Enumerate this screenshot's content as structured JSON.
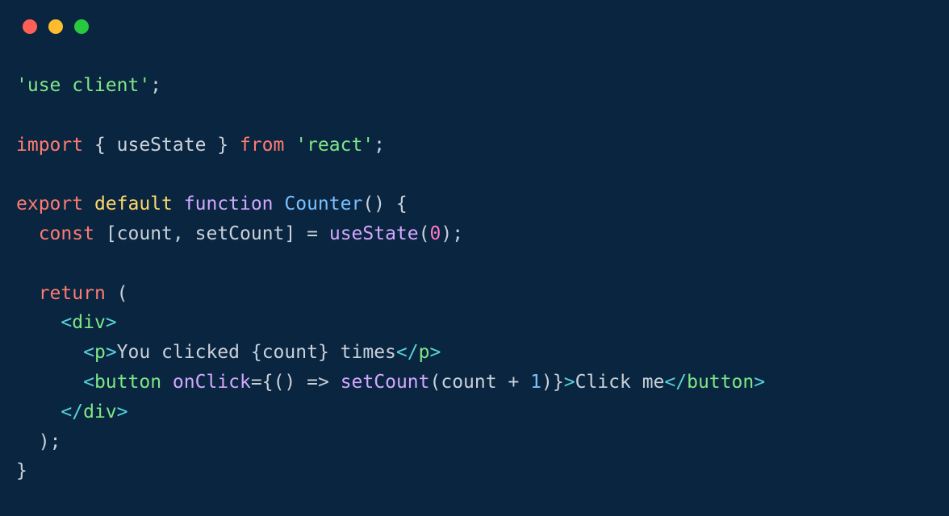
{
  "traffic_lights": {
    "red": "#ff5f57",
    "yellow": "#febc2e",
    "green": "#28c840"
  },
  "code": {
    "line1": {
      "directive": "'use client'",
      "semi": ";"
    },
    "line3": {
      "import_kw": "import",
      "lbrace": " { ",
      "name": "useState",
      "rbrace": " } ",
      "from_kw": "from",
      "sp": " ",
      "module": "'react'",
      "semi": ";"
    },
    "line5": {
      "export_kw": "export",
      "sp1": " ",
      "default_kw": "default",
      "sp2": " ",
      "function_kw": "function",
      "sp3": " ",
      "name": "Counter",
      "parens": "()",
      "sp4": " ",
      "lbrace": "{"
    },
    "line6": {
      "indent": "  ",
      "const_kw": "const",
      "sp": " ",
      "lbracket": "[",
      "var1": "count",
      "comma": ", ",
      "var2": "setCount",
      "rbracket": "]",
      "sp2": " ",
      "eq": "=",
      "sp3": " ",
      "call": "useState",
      "lparen": "(",
      "arg": "0",
      "rparen": ")",
      "semi": ";"
    },
    "line8": {
      "indent": "  ",
      "return_kw": "return",
      "sp": " ",
      "lparen": "("
    },
    "line9": {
      "indent": "    ",
      "lt": "<",
      "tag": "div",
      "gt": ">"
    },
    "line10": {
      "indent": "      ",
      "lt": "<",
      "tag": "p",
      "gt": ">",
      "text1": "You clicked ",
      "lbrace": "{",
      "expr": "count",
      "rbrace": "}",
      "text2": " times",
      "lt2": "</",
      "tag2": "p",
      "gt2": ">"
    },
    "line11": {
      "indent": "      ",
      "lt": "<",
      "tag": "button",
      "sp": " ",
      "attr": "onClick",
      "eq": "=",
      "lbrace": "{",
      "lparen": "(",
      "rparen": ")",
      "sp2": " ",
      "arrow": "=>",
      "sp3": " ",
      "call": "setCount",
      "lparen2": "(",
      "arg1": "count",
      "sp4": " ",
      "plus": "+",
      "sp5": " ",
      "arg2": "1",
      "rparen2": ")",
      "rbrace": "}",
      "gt": ">",
      "text": "Click me",
      "lt2": "</",
      "tag2": "button",
      "gt2": ">"
    },
    "line12": {
      "indent": "    ",
      "lt": "</",
      "tag": "div",
      "gt": ">"
    },
    "line13": {
      "indent": "  ",
      "rparen": ")",
      "semi": ";"
    },
    "line14": {
      "rbrace": "}"
    }
  }
}
